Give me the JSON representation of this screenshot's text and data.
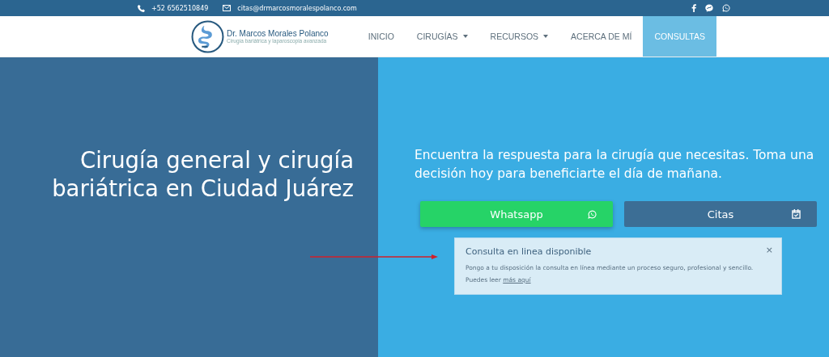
{
  "top_bar": {
    "phone": "+52 6562510849",
    "email": "citas@drmarcosmoralespolanco.com"
  },
  "logo": {
    "name": "Dr. Marcos Morales Polanco",
    "tagline": "Cirugía bariátrica y laparoscopia avanzada"
  },
  "nav": [
    {
      "label": "INICIO",
      "dropdown": false,
      "selected": false
    },
    {
      "label": "CIRUGÍAS",
      "dropdown": true,
      "selected": false
    },
    {
      "label": "RECURSOS",
      "dropdown": true,
      "selected": false
    },
    {
      "label": "ACERCA DE MÍ",
      "dropdown": false,
      "selected": false
    },
    {
      "label": "CONSULTAS",
      "dropdown": false,
      "selected": true
    }
  ],
  "hero": {
    "headline": "Cirugía general y cirugía bariátrica en Ciudad Juárez",
    "subtitle": "Encuentra la respuesta para la cirugía que necesitas. Toma una decisión hoy para beneficiarte el día de mañana.",
    "buttons": [
      {
        "label": "Whatsapp",
        "kind": "whatsapp"
      },
      {
        "label": "Citas",
        "kind": "calendar"
      }
    ],
    "notice": {
      "title": "Consulta en linea disponible",
      "text": "Pongo a tu disposición la consulta en línea mediante un proceso seguro, profesional y sencillo.",
      "link_prefix": "Puedes leer",
      "link": "más aquí",
      "close": "×"
    }
  }
}
